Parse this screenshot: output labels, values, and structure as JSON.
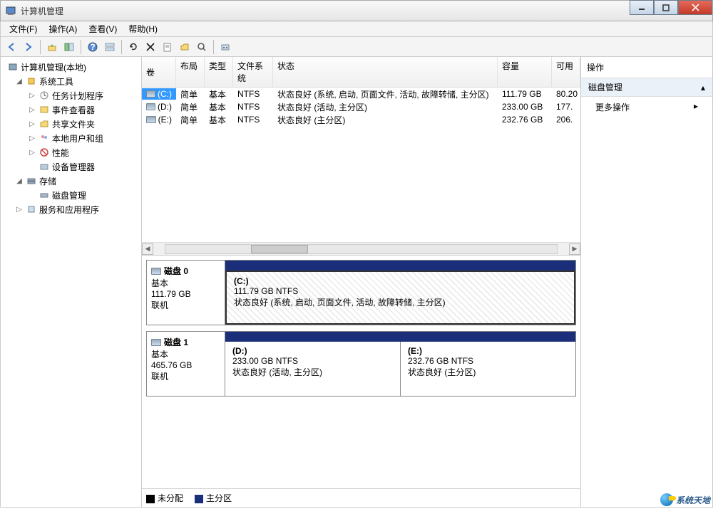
{
  "window": {
    "title": "计算机管理"
  },
  "menu": {
    "file": "文件(F)",
    "action": "操作(A)",
    "view": "查看(V)",
    "help": "帮助(H)"
  },
  "tree": {
    "root": "计算机管理(本地)",
    "systools": "系统工具",
    "sched": "任务计划程序",
    "eventv": "事件查看器",
    "shared": "共享文件夹",
    "users": "本地用户和组",
    "perf": "性能",
    "devmgr": "设备管理器",
    "storage": "存储",
    "diskmgmt": "磁盘管理",
    "services": "服务和应用程序"
  },
  "volhead": {
    "vol": "卷",
    "layout": "布局",
    "type": "类型",
    "fs": "文件系统",
    "status": "状态",
    "cap": "容量",
    "free": "可用"
  },
  "volumes": [
    {
      "name": "(C:)",
      "layout": "简单",
      "type": "基本",
      "fs": "NTFS",
      "status": "状态良好 (系统, 启动, 页面文件, 活动, 故障转储, 主分区)",
      "cap": "111.79 GB",
      "free": "80.20"
    },
    {
      "name": "(D:)",
      "layout": "简单",
      "type": "基本",
      "fs": "NTFS",
      "status": "状态良好 (活动, 主分区)",
      "cap": "233.00 GB",
      "free": "177."
    },
    {
      "name": "(E:)",
      "layout": "简单",
      "type": "基本",
      "fs": "NTFS",
      "status": "状态良好 (主分区)",
      "cap": "232.76 GB",
      "free": "206."
    }
  ],
  "disks": [
    {
      "label": "磁盘 0",
      "type": "基本",
      "size": "111.79 GB",
      "state": "联机",
      "parts": [
        {
          "name": "(C:)",
          "size": "111.79 GB NTFS",
          "status": "状态良好 (系统, 启动, 页面文件, 活动, 故障转储, 主分区)",
          "selected": true
        }
      ]
    },
    {
      "label": "磁盘 1",
      "type": "基本",
      "size": "465.76 GB",
      "state": "联机",
      "parts": [
        {
          "name": "(D:)",
          "size": "233.00 GB NTFS",
          "status": "状态良好 (活动, 主分区)"
        },
        {
          "name": "(E:)",
          "size": "232.76 GB NTFS",
          "status": "状态良好 (主分区)"
        }
      ]
    }
  ],
  "legend": {
    "unalloc": "未分配",
    "primary": "主分区"
  },
  "actions": {
    "head": "操作",
    "section": "磁盘管理",
    "more": "更多操作"
  },
  "watermark": "系统天地"
}
